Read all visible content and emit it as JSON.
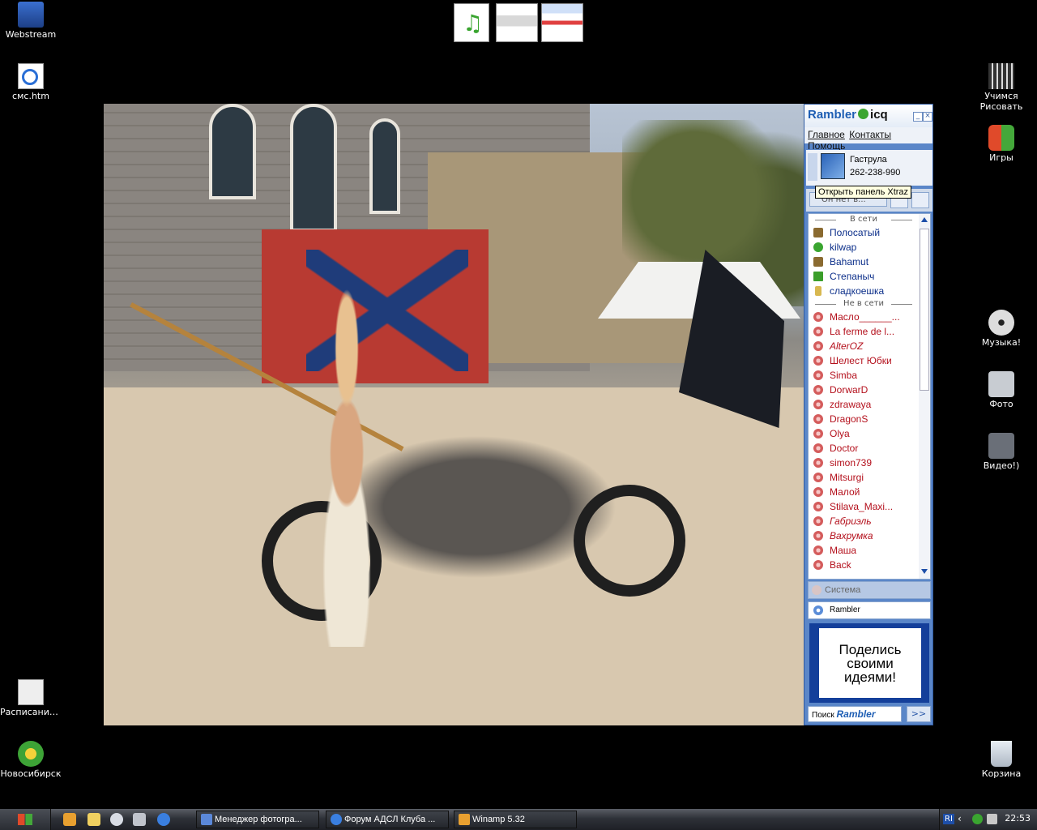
{
  "desktop": {
    "icons_left": [
      {
        "label": "Webstream",
        "icon": "network-computer-icon"
      },
      {
        "label": "смс.htm",
        "icon": "ie-document-icon"
      },
      {
        "label": "Расписание...",
        "icon": "document-icon"
      },
      {
        "label": "Новосибирск",
        "icon": "globe-shortcut-icon"
      }
    ],
    "icons_right": [
      {
        "label": "Учимся Рисовать",
        "icon": "film-icon"
      },
      {
        "label": "Игры",
        "icon": "windows-flag-icon"
      },
      {
        "label": "Музыка!",
        "icon": "cd-icon"
      },
      {
        "label": "Фото",
        "icon": "camera-icon"
      },
      {
        "label": "Видео!)",
        "icon": "camcorder-icon"
      },
      {
        "label": "Корзина",
        "icon": "recycle-bin-icon"
      }
    ]
  },
  "icq": {
    "brand": "Rambler",
    "brand2": "icq",
    "menu": [
      "Главное",
      "Контакты",
      "Помощь"
    ],
    "user_name": "Гаструла",
    "user_id": "262-238-990",
    "status_text": "Он нет в...",
    "tooltip": "Открыть панель Xtraz",
    "group_online": "В сети",
    "group_offline": "Не в сети",
    "online": [
      {
        "name": "Полосатый",
        "icon": "bot"
      },
      {
        "name": "kilwap",
        "icon": ""
      },
      {
        "name": "Bahamut",
        "icon": "bot"
      },
      {
        "name": "Степаныч",
        "icon": "tv"
      },
      {
        "name": "сладкоешка",
        "icon": "ph"
      }
    ],
    "offline": [
      {
        "name": "Масло______...",
        "italic": false
      },
      {
        "name": "La ferme de l...",
        "italic": false
      },
      {
        "name": "AlterOZ",
        "italic": true
      },
      {
        "name": "Шелест Юбки",
        "italic": false
      },
      {
        "name": "Simba",
        "italic": false
      },
      {
        "name": "DorwarD",
        "italic": false
      },
      {
        "name": "zdrawaya",
        "italic": false
      },
      {
        "name": "DragonS",
        "italic": false
      },
      {
        "name": "Olya",
        "italic": false
      },
      {
        "name": "Doctor",
        "italic": false
      },
      {
        "name": "simon739",
        "italic": false
      },
      {
        "name": "Mitsurgi",
        "italic": false
      },
      {
        "name": "Малой",
        "italic": false
      },
      {
        "name": "Stilava_Maxi...",
        "italic": false
      },
      {
        "name": "Габриэль",
        "italic": true
      },
      {
        "name": "Вахрумка",
        "italic": true
      },
      {
        "name": "Маша",
        "italic": false
      },
      {
        "name": "Back",
        "italic": false
      }
    ],
    "system_label": "Система",
    "rambler_label": "Rambler",
    "ad_text": [
      "Поделись",
      "своими",
      "идеями!"
    ],
    "search_label": "Поиск",
    "search_brand": "Rambler",
    "search_go": ">>"
  },
  "taskbar": {
    "buttons": [
      {
        "label": "Менеджер фотогра...",
        "icon": "photo-manager-icon"
      },
      {
        "label": "Форум АДСЛ Клуба ...",
        "icon": "ie-icon"
      },
      {
        "label": "Winamp 5.32",
        "icon": "winamp-icon"
      }
    ],
    "tray_lang": "RI",
    "clock": "22:53"
  }
}
